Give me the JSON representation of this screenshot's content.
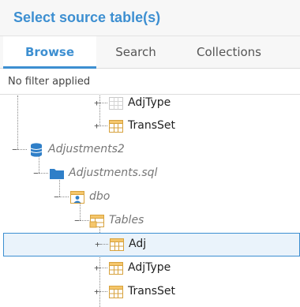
{
  "dialog": {
    "title": "Select source table(s)"
  },
  "tabs": [
    {
      "label": "Browse",
      "active": true
    },
    {
      "label": "Search",
      "active": false
    },
    {
      "label": "Collections",
      "active": false
    }
  ],
  "filter": {
    "status": "No filter applied"
  },
  "tree": {
    "rows": [
      {
        "label": "AdjType",
        "type": "table",
        "italic": false
      },
      {
        "label": "TransSet",
        "type": "table",
        "italic": false
      },
      {
        "label": "Adjustments2",
        "type": "database",
        "italic": true
      },
      {
        "label": "Adjustments.sql",
        "type": "folder",
        "italic": true
      },
      {
        "label": "dbo",
        "type": "schema",
        "italic": true
      },
      {
        "label": "Tables",
        "type": "tables-group",
        "italic": true
      },
      {
        "label": "Adj",
        "type": "table",
        "italic": false,
        "selected": true
      },
      {
        "label": "AdjType",
        "type": "table",
        "italic": false
      },
      {
        "label": "TransSet",
        "type": "table",
        "italic": false
      }
    ]
  },
  "colors": {
    "accent": "#3d8fd1",
    "selection_bg": "#eaf3fb",
    "table_icon_header": "#f5c66b",
    "database_icon": "#2f7fc8",
    "folder_icon": "#2f7fc8"
  }
}
